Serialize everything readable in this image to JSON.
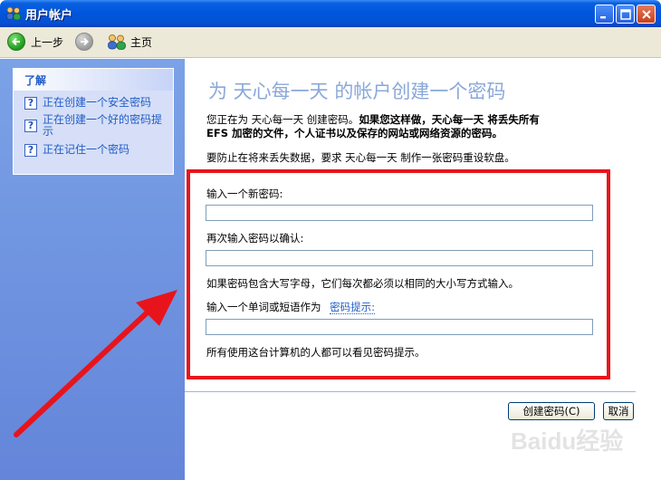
{
  "window": {
    "title": "用户帐户"
  },
  "toolbar": {
    "back_label": "上一步",
    "home_label": "主页"
  },
  "learn": {
    "title": "了解",
    "items": [
      {
        "label": "正在创建一个安全密码"
      },
      {
        "label_line1": "正在创建一个好的密码提",
        "label_line2": "示"
      },
      {
        "label": "正在记住一个密码"
      }
    ]
  },
  "main": {
    "heading": "为 天心每一天 的帐户创建一个密码",
    "intro_line1_normal": "您正在为 天心每一天 创建密码。",
    "intro_line1_bold": "如果您这样做，天心每一天 将丢失所有",
    "intro_line2_bold": "EFS 加密的文件，个人证书以及保存的网站或网络资源的密码。",
    "reset_note": "要防止在将来丢失数据，要求 天心每一天 制作一张密码重设软盘。",
    "new_password_label": "输入一个新密码:",
    "confirm_password_label": "再次输入密码以确认:",
    "case_note": "如果密码包含大写字母，它们每次都必须以相同的大小写方式输入。",
    "hint_label": "输入一个单词或短语作为",
    "hint_link": "密码提示:",
    "hint_visible_note": "所有使用这台计算机的人都可以看见密码提示。",
    "new_password_value": "",
    "confirm_password_value": "",
    "hint_value": ""
  },
  "buttons": {
    "create": "创建密码(C)",
    "cancel": "取消"
  },
  "watermark": {
    "text": "Baidu经验"
  },
  "colors": {
    "annotation_red": "#e8141c",
    "title_blue": "#0056dc",
    "link_blue": "#215dc6"
  }
}
